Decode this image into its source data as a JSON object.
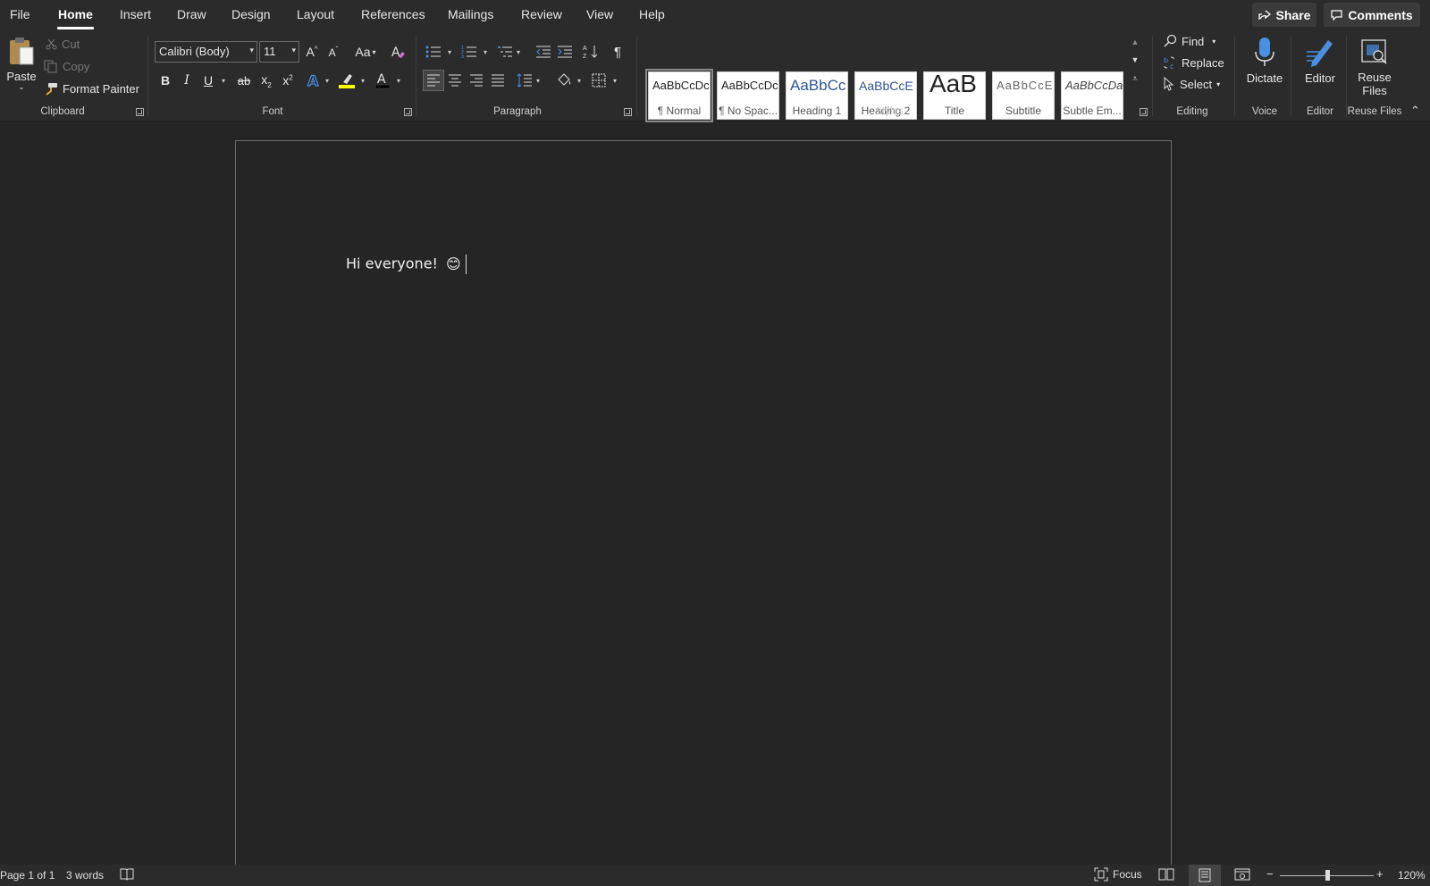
{
  "menu": {
    "tabs": [
      {
        "label": "File"
      },
      {
        "label": "Home"
      },
      {
        "label": "Insert"
      },
      {
        "label": "Draw"
      },
      {
        "label": "Design"
      },
      {
        "label": "Layout"
      },
      {
        "label": "References"
      },
      {
        "label": "Mailings"
      },
      {
        "label": "Review"
      },
      {
        "label": "View"
      },
      {
        "label": "Help"
      }
    ],
    "active_tab": "Home",
    "share_label": "Share",
    "comments_label": "Comments"
  },
  "ribbon": {
    "clipboard": {
      "paste_label": "Paste",
      "cut_label": "Cut",
      "copy_label": "Copy",
      "format_painter_label": "Format Painter",
      "group_label": "Clipboard"
    },
    "font": {
      "font_name": "Calibri (Body)",
      "font_size": "11",
      "group_label": "Font",
      "bold_label": "B",
      "italic_label": "I",
      "underline_label": "U",
      "highlight_color": "#ffff00",
      "font_color": "#000000"
    },
    "paragraph": {
      "group_label": "Paragraph"
    },
    "styles": {
      "group_label": "Styles",
      "items": [
        {
          "preview": "AaBbCcDc",
          "name": "¶ Normal"
        },
        {
          "preview": "AaBbCcDc",
          "name": "¶ No Spac..."
        },
        {
          "preview": "AaBbCc",
          "name": "Heading 1"
        },
        {
          "preview": "AaBbCcE",
          "name": "Heading 2"
        },
        {
          "preview": "AaB",
          "name": "Title"
        },
        {
          "preview": "AaBbCcE",
          "name": "Subtitle"
        },
        {
          "preview": "AaBbCcDa",
          "name": "Subtle Em..."
        }
      ]
    },
    "editing": {
      "find_label": "Find",
      "replace_label": "Replace",
      "select_label": "Select",
      "group_label": "Editing"
    },
    "voice": {
      "dictate_label": "Dictate",
      "group_label": "Voice"
    },
    "editor": {
      "editor_label": "Editor",
      "group_label": "Editor"
    },
    "reuse": {
      "line1": "Reuse",
      "line2": "Files",
      "group_label": "Reuse Files"
    }
  },
  "document": {
    "text": "Hi everyone!",
    "emoji": "😊"
  },
  "status": {
    "page_info": "Page 1 of 1",
    "word_count": "3 words",
    "focus_label": "Focus",
    "zoom_label": "120%",
    "zoom_percent": 120
  },
  "colors": {
    "accent_blue": "#4a8fe0",
    "background": "#252525",
    "ribbon": "#2b2b2b"
  }
}
